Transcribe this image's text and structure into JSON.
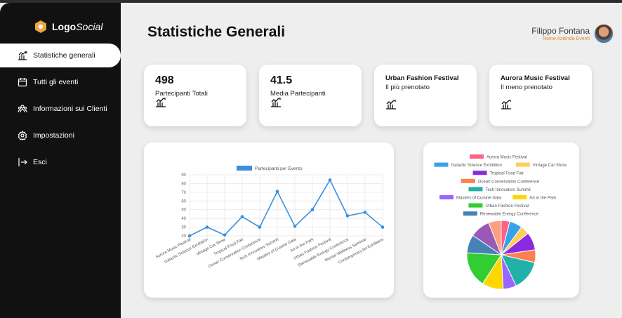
{
  "logo": {
    "brand_bold": "Logo",
    "brand_italic": "Social"
  },
  "nav": [
    {
      "label": "Statistiche generali",
      "icon": "chart-icon",
      "active": true
    },
    {
      "label": "Tutti gli eventi",
      "icon": "calendar-icon",
      "active": false
    },
    {
      "label": "Informazioni sui Clienti",
      "icon": "users-icon",
      "active": false
    },
    {
      "label": "Impostazioni",
      "icon": "gear-icon",
      "active": false
    },
    {
      "label": "Esci",
      "icon": "logout-icon",
      "active": false
    }
  ],
  "header": {
    "title": "Statistiche Generali"
  },
  "user": {
    "name": "Filippo Fontana",
    "company": "Nome Azienda Eventi"
  },
  "stats": [
    {
      "value": "498",
      "label": "Partecipanti Totali"
    },
    {
      "value": "41.5",
      "label": "Media Partecipanti"
    },
    {
      "title": "Urban Fashion Festival",
      "subtitle": "Il più prenotato"
    },
    {
      "title": "Aurora Music Festival",
      "subtitle": "Il meno prenotato"
    }
  ],
  "colors": {
    "accent": "#e38b2d",
    "sidebar": "#111111",
    "line": "#3b8fdc"
  },
  "chart_data": [
    {
      "type": "line",
      "categories": [
        "Aurora Music Festival",
        "Galactic Science Exhibition",
        "Vintage Car Show",
        "Tropical Food Fair",
        "Ocean Conservation Conference",
        "Tech Innovators Summit",
        "Masters of Cuisine Gala",
        "Art in the Park",
        "Urban Fashion Festival",
        "Renewable Energy Conference",
        "Mental Wellness Seminar",
        "Contemporary Art Exhibition"
      ],
      "series": [
        {
          "name": "Partecipanti per Evento",
          "values": [
            20,
            30,
            21,
            42,
            30,
            71,
            31,
            50,
            84,
            43,
            47,
            30
          ]
        }
      ],
      "yticks": [
        20,
        30,
        40,
        50,
        60,
        70,
        80,
        90
      ],
      "ylim": [
        20,
        90
      ],
      "grid": true,
      "legend": "top"
    },
    {
      "type": "pie",
      "labels": [
        "Aurora Music Festival",
        "Galactic Science Exhibition",
        "Vintage Car Show",
        "Tropical Food Fair",
        "Ocean Conservation Conference",
        "Tech Innovators Summit",
        "Masters of Cuisine Gala",
        "Art in the Park",
        "Urban Fashion Festival",
        "Renewable Energy Conference",
        "Mental Wellness Seminar",
        "Contemporary Art Exhibition"
      ],
      "values": [
        20,
        30,
        21,
        42,
        30,
        71,
        31,
        50,
        84,
        43,
        47,
        30
      ],
      "colors": [
        "#ff6384",
        "#36a2eb",
        "#ffce56",
        "#8a2be2",
        "#ff7f50",
        "#20b2aa",
        "#9966ff",
        "#ffd700",
        "#32cd32",
        "#4682b4",
        "#9b59b6",
        "#ff9f80"
      ],
      "legend_labels": [
        "Aurora Music Festival",
        "Galactic Science Exhibition",
        "Vintage Car Show",
        "Tropical Food Fair",
        "Ocean Conservation Conference",
        "Tech Innovators Summit",
        "Masters of Cuisine Gala",
        "Art in the Park",
        "Urban Fashion Festival",
        "Renewable Energy Conference"
      ],
      "legend": "top"
    }
  ]
}
